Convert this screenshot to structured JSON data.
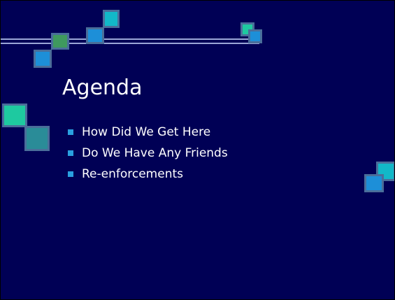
{
  "slide": {
    "title": "Agenda",
    "bullets": [
      "How Did We Get Here",
      "Do We Have Any Friends",
      "Re-enforcements"
    ]
  },
  "colors": {
    "background": "#000055",
    "text": "#ffffff",
    "bullet_marker": "#2aa0e0",
    "decor_teal": "#12b8c8",
    "decor_blue": "#1d8fd8",
    "decor_green": "#1ec9a0"
  },
  "icons": {
    "bullet": "square-bullet-icon"
  }
}
